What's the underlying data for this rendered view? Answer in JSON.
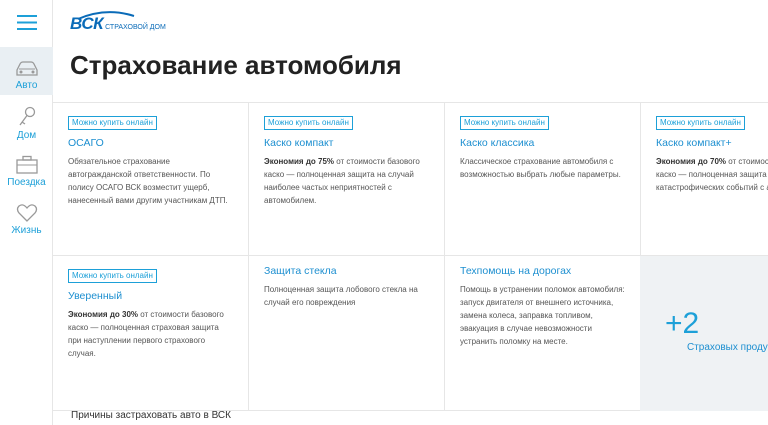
{
  "sidebar": {
    "items": [
      {
        "label": "Авто",
        "icon": "car-icon",
        "active": true
      },
      {
        "label": "Дом",
        "icon": "key-icon",
        "active": false
      },
      {
        "label": "Поездка",
        "icon": "suitcase-icon",
        "active": false
      },
      {
        "label": "Жизнь",
        "icon": "heart-icon",
        "active": false
      }
    ]
  },
  "logo": {
    "main": "ВСК",
    "sub": "СТРАХОВОЙ ДОМ"
  },
  "page_title": "Страхование автомобиля",
  "cards": [
    {
      "badge": "Можно купить онлайн",
      "title": "ОСАГО",
      "desc_bold": "",
      "desc": "Обязательное страхование автогражданской ответственности. По полису ОСАГО ВСК возместит ущерб, нанесенный вами другим участникам ДТП."
    },
    {
      "badge": "Можно купить онлайн",
      "title": "Каско компакт",
      "desc_bold": "Экономия до 75%",
      "desc": " от стоимости базового каско — полноценная защита на случай наиболее частых неприятностей с автомобилем."
    },
    {
      "badge": "Можно купить онлайн",
      "title": "Каско классика",
      "desc_bold": "",
      "desc": "Классическое страхование автомобиля с возможностью выбрать любые параметры."
    },
    {
      "badge": "Можно купить онлайн",
      "title": "Каско компакт+",
      "desc_bold": "Экономия до 70%",
      "desc": " от стоимости базового каско — полноценная защита на случай катастрофических событий с ав"
    },
    {
      "badge": "Можно купить онлайн",
      "title": "Уверенный",
      "desc_bold": "Экономия до 30%",
      "desc": " от стоимости базового каско — полноценная страховая защита при наступлении первого страхового случая."
    },
    {
      "badge": "",
      "title": "Защита стекла",
      "desc_bold": "",
      "desc": "Полноценная защита лобового стекла на случай его повреждения"
    },
    {
      "badge": "",
      "title": "Техпомощь на дорогах",
      "desc_bold": "",
      "desc": "Помощь в устранении поломок автомобиля: запуск двигателя от внешнего источника, замена колеса, заправка топливом, эвакуация в случае невозможности устранить поломку на месте."
    }
  ],
  "more": {
    "count": "+2",
    "label": "Страховых проду"
  },
  "reasons_link": "Причины застраховать авто в ВСК",
  "colors": {
    "accent": "#1da0d8",
    "title_blue": "#1d8fd0",
    "logo_blue": "#0a6bb8"
  }
}
